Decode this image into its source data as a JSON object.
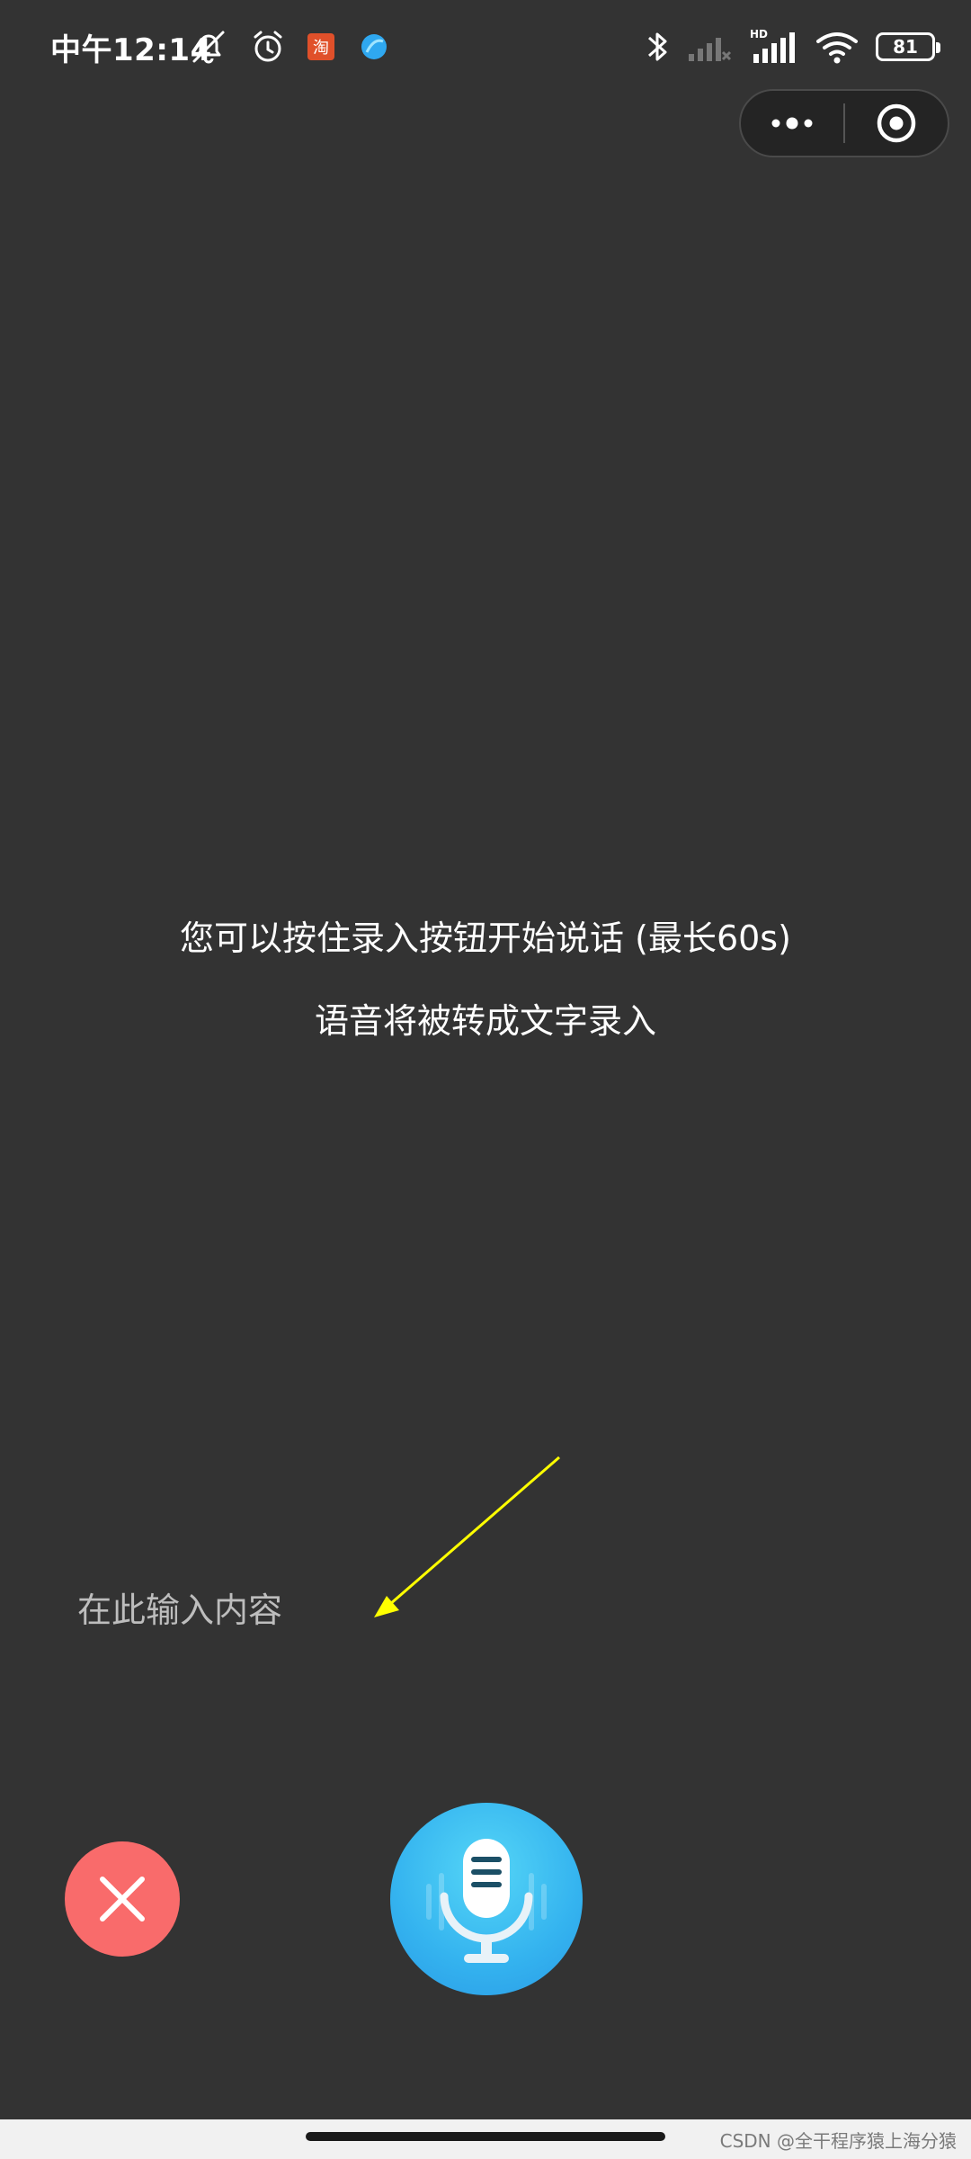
{
  "status_bar": {
    "time": "中午12:14",
    "battery": "81",
    "network_label": "HD",
    "icons_left": [
      "mute-icon",
      "alarm-icon",
      "taobao-icon",
      "app-icon"
    ],
    "icons_right": [
      "bluetooth-icon",
      "signal-icon",
      "hd-signal-icon",
      "wifi-icon",
      "battery-icon"
    ],
    "taobao_glyph": "淘"
  },
  "capsule": {
    "menu_icon": "more-dots-icon",
    "close_icon": "target-close-icon"
  },
  "hints": {
    "line1": "您可以按住录入按钮开始说话 (最长60s)",
    "line2": "语音将被转成文字录入"
  },
  "input": {
    "placeholder": "在此输入内容",
    "value": ""
  },
  "buttons": {
    "cancel_icon": "close-x-icon",
    "record_icon": "microphone-icon"
  },
  "colors": {
    "background": "#333333",
    "cancel": "#f96b6b",
    "record": "#34b3ef",
    "arrow": "#ffff00"
  },
  "watermark": "CSDN @全干程序猿上海分猿"
}
